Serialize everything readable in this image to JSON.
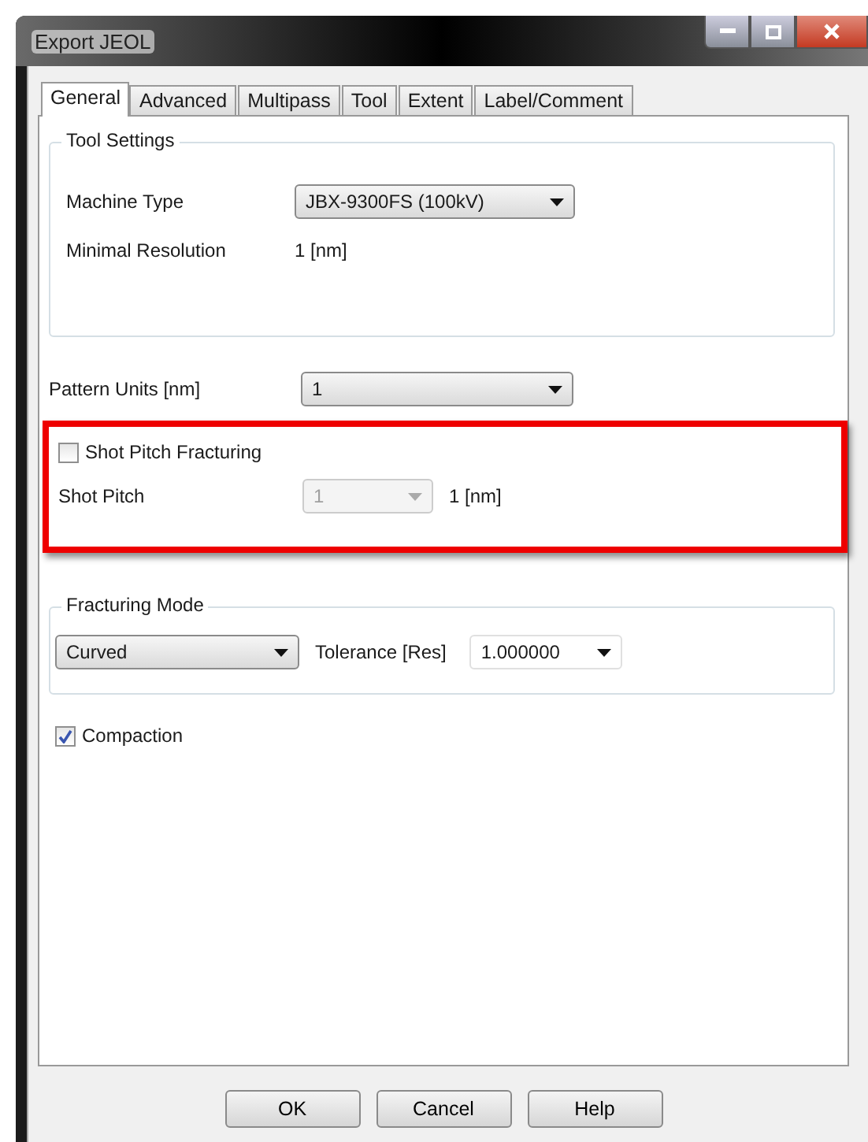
{
  "window": {
    "title": "Export JEOL"
  },
  "tabs": [
    {
      "label": "General",
      "selected": true
    },
    {
      "label": "Advanced",
      "selected": false
    },
    {
      "label": "Multipass",
      "selected": false
    },
    {
      "label": "Tool",
      "selected": false
    },
    {
      "label": "Extent",
      "selected": false
    },
    {
      "label": "Label/Comment",
      "selected": false
    }
  ],
  "tool_settings": {
    "title": "Tool Settings",
    "machine_type_label": "Machine Type",
    "machine_type": "JBX-9300FS (100kV)",
    "resolution_label": "Minimal Resolution",
    "resolution": "1 [nm]"
  },
  "pattern_units": {
    "label": "Pattern Units [nm]",
    "value": "1"
  },
  "shot_pitch": {
    "highlighted": true,
    "fracturing_label": "Shot Pitch Fracturing",
    "fracturing_checked": false,
    "label": "Shot Pitch",
    "value": "1",
    "disabled": true,
    "reading": "1 [nm]"
  },
  "fracturing_mode": {
    "title": "Fracturing Mode",
    "mode": "Curved",
    "tolerance_label": "Tolerance [Res]",
    "tolerance": "1.000000"
  },
  "compaction": {
    "label": "Compaction",
    "checked": true
  },
  "buttons": [
    "OK",
    "Cancel",
    "Help"
  ]
}
